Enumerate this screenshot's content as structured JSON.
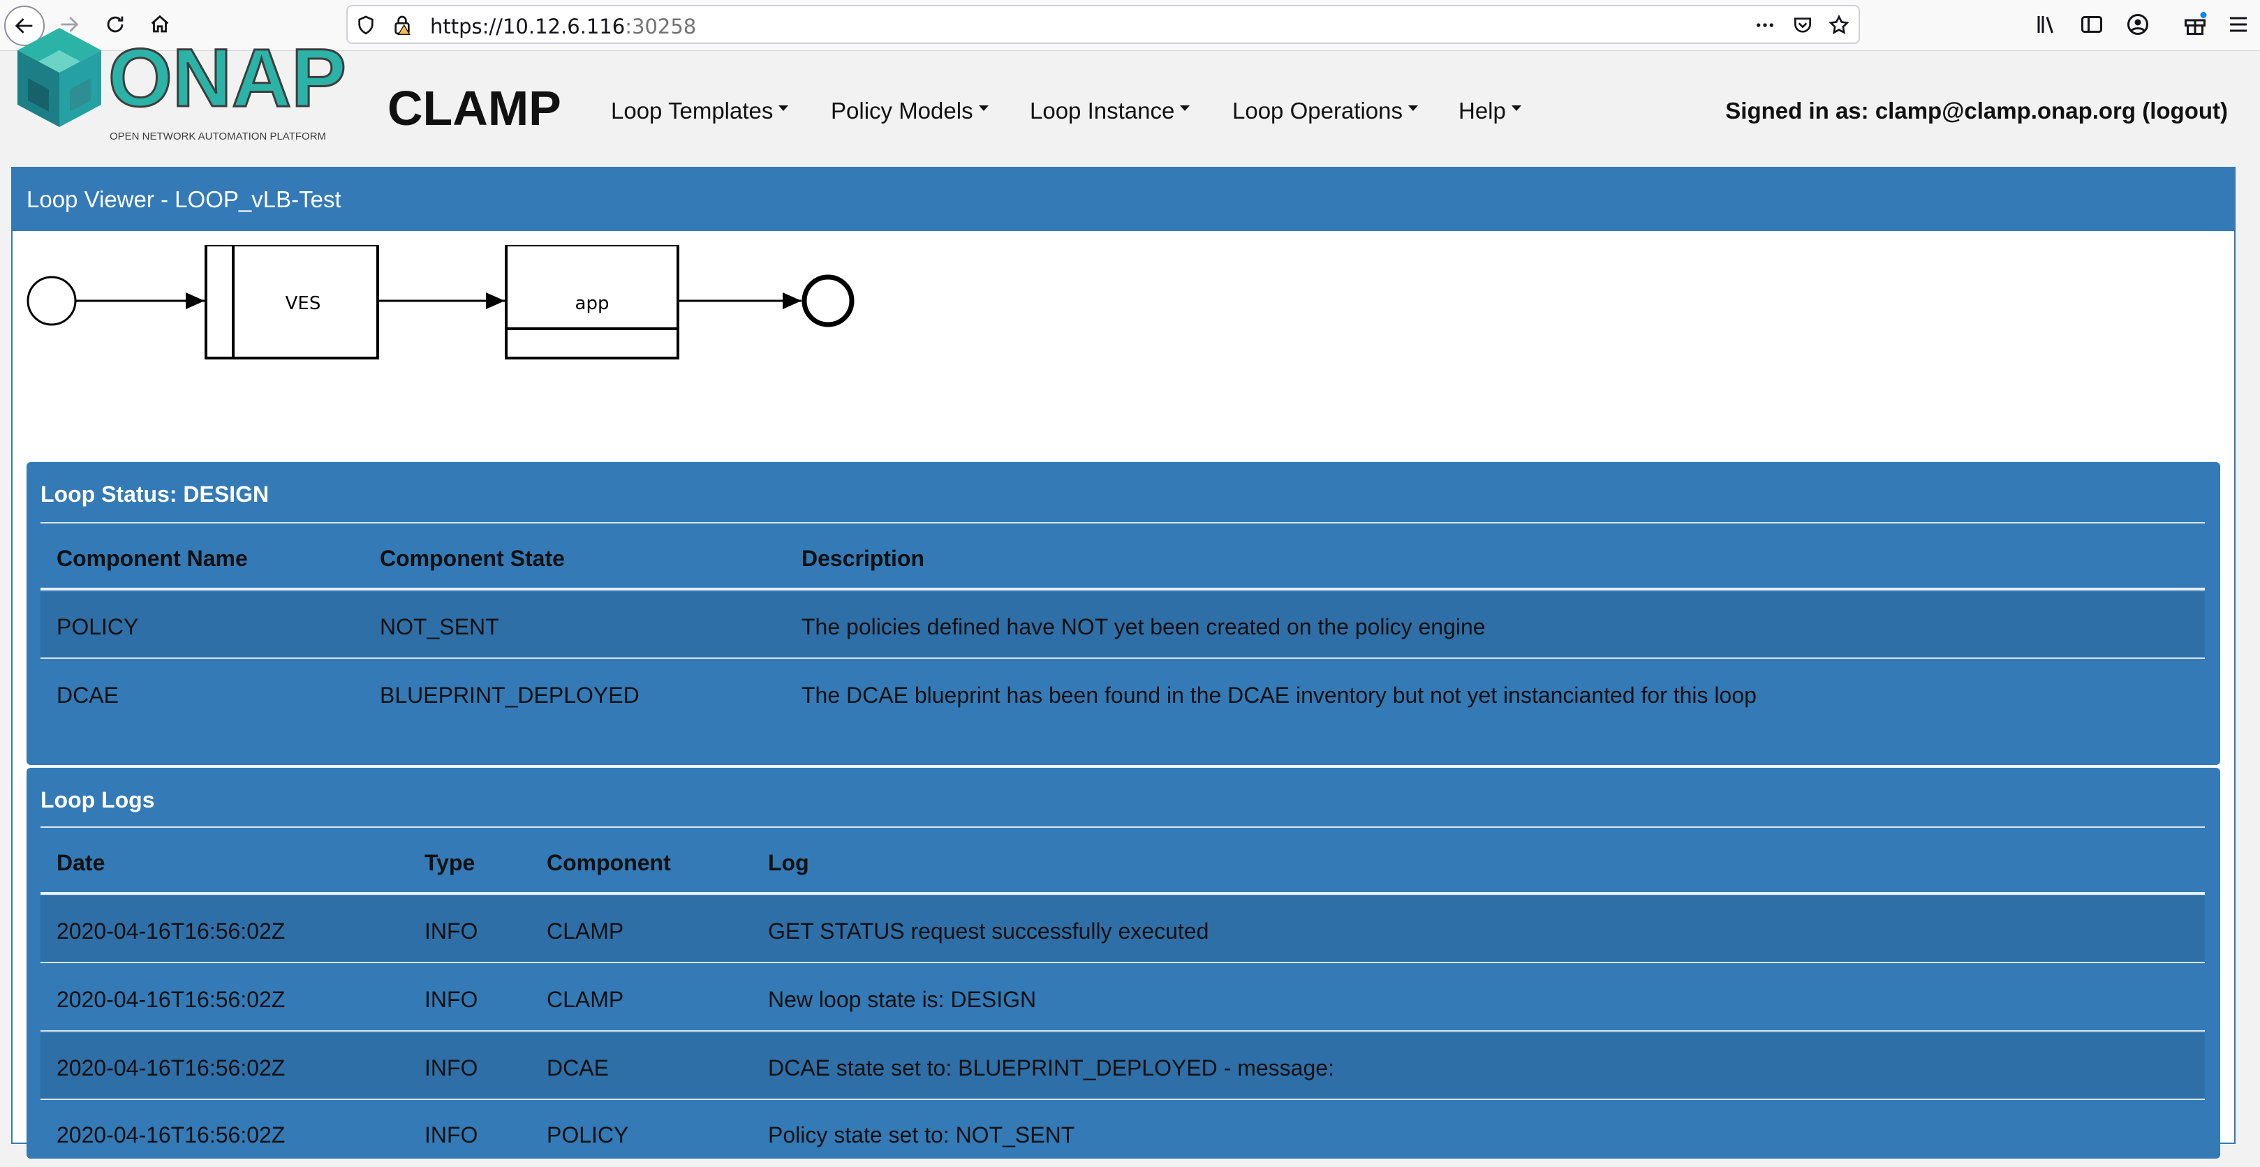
{
  "browser": {
    "url_host": "https://10.12.6.116",
    "url_port": ":30258"
  },
  "header": {
    "logo_text": "ONAP",
    "logo_subtext": "OPEN NETWORK AUTOMATION PLATFORM",
    "app_title": "CLAMP",
    "menus": [
      "Loop Templates",
      "Policy Models",
      "Loop Instance",
      "Loop Operations",
      "Help"
    ],
    "signed_in": "Signed in as: clamp@clamp.onap.org (logout)"
  },
  "viewer": {
    "title": "Loop Viewer - LOOP_vLB-Test",
    "diagram": {
      "nodes": [
        "VES",
        "app"
      ]
    }
  },
  "status": {
    "title": "Loop Status: DESIGN",
    "columns": [
      "Component Name",
      "Component State",
      "Description"
    ],
    "rows": [
      [
        "POLICY",
        "NOT_SENT",
        "The policies defined have NOT yet been created on the policy engine"
      ],
      [
        "DCAE",
        "BLUEPRINT_DEPLOYED",
        "The DCAE blueprint has been found in the DCAE inventory but not yet instancianted for this loop"
      ]
    ]
  },
  "logs": {
    "title": "Loop Logs",
    "columns": [
      "Date",
      "Type",
      "Component",
      "Log"
    ],
    "rows": [
      [
        "2020-04-16T16:56:02Z",
        "INFO",
        "CLAMP",
        "GET STATUS request successfully executed"
      ],
      [
        "2020-04-16T16:56:02Z",
        "INFO",
        "CLAMP",
        "New loop state is: DESIGN"
      ],
      [
        "2020-04-16T16:56:02Z",
        "INFO",
        "DCAE",
        "DCAE state set to: BLUEPRINT_DEPLOYED - message:"
      ],
      [
        "2020-04-16T16:56:02Z",
        "INFO",
        "POLICY",
        "Policy state set to: NOT_SENT"
      ]
    ]
  },
  "colors": {
    "primary": "#337ab7",
    "stripe": "#2f6fa8",
    "logo_teal": "#2bb3a8",
    "logo_dark": "#3d3d3d"
  }
}
